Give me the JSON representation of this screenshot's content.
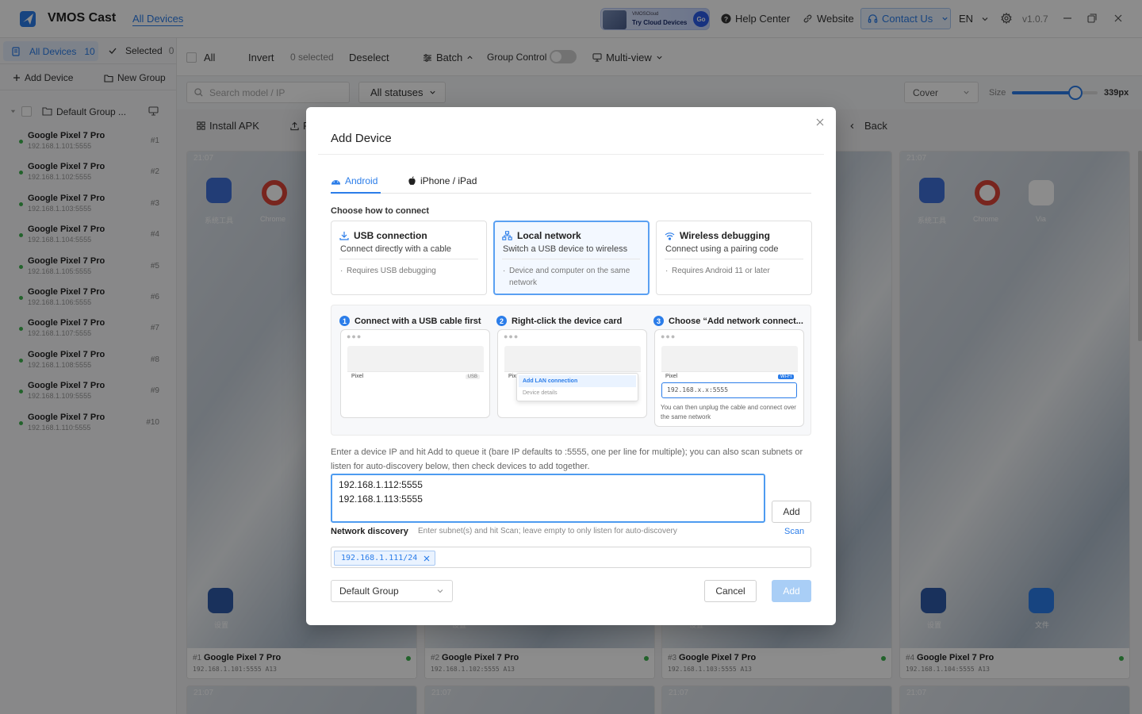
{
  "app": {
    "title": "VMOS Cast",
    "version": "v1.0.7",
    "brand_color": "#2b7de9"
  },
  "titlebar": {
    "all_devices": "All Devices",
    "banner_small": "VMOSCloud",
    "banner_text": "Try Cloud Devices",
    "banner_go": "Go",
    "help": "Help Center",
    "website": "Website",
    "contact": "Contact Us",
    "lang": "EN"
  },
  "sidebar": {
    "tab_all": "All Devices",
    "tab_all_count": "10",
    "tab_selected": "Selected",
    "tab_selected_count": "0",
    "add_device": "Add Device",
    "new_group": "New Group",
    "group_name": "Default Group ...",
    "devices": [
      {
        "name": "Google Pixel 7 Pro",
        "ip": "192.168.1.101:5555",
        "num": "#1"
      },
      {
        "name": "Google Pixel 7 Pro",
        "ip": "192.168.1.102:5555",
        "num": "#2"
      },
      {
        "name": "Google Pixel 7 Pro",
        "ip": "192.168.1.103:5555",
        "num": "#3"
      },
      {
        "name": "Google Pixel 7 Pro",
        "ip": "192.168.1.104:5555",
        "num": "#4"
      },
      {
        "name": "Google Pixel 7 Pro",
        "ip": "192.168.1.105:5555",
        "num": "#5"
      },
      {
        "name": "Google Pixel 7 Pro",
        "ip": "192.168.1.106:5555",
        "num": "#6"
      },
      {
        "name": "Google Pixel 7 Pro",
        "ip": "192.168.1.107:5555",
        "num": "#7"
      },
      {
        "name": "Google Pixel 7 Pro",
        "ip": "192.168.1.108:5555",
        "num": "#8"
      },
      {
        "name": "Google Pixel 7 Pro",
        "ip": "192.168.1.109:5555",
        "num": "#9"
      },
      {
        "name": "Google Pixel 7 Pro",
        "ip": "192.168.1.110:5555",
        "num": "#10"
      }
    ]
  },
  "toolbar": {
    "all": "All",
    "invert": "Invert",
    "selected_count": "0 selected",
    "deselect": "Deselect",
    "batch": "Batch",
    "group_control": "Group Control",
    "multiview": "Multi-view"
  },
  "filter": {
    "search_placeholder": "Search model / IP",
    "status": "All statuses",
    "cover": "Cover",
    "size_label": "Size",
    "size_value": "339px",
    "size_fraction": 0.75
  },
  "toolbar2": {
    "install_apk": "Install APK",
    "partial": "F",
    "back": "Back"
  },
  "cards": [
    {
      "num": "#1",
      "name": "Google Pixel 7 Pro",
      "ip": "192.168.1.101:5555 A13",
      "time": "21:07"
    },
    {
      "num": "#2",
      "name": "Google Pixel 7 Pro",
      "ip": "192.168.1.102:5555 A13",
      "time": "21:07"
    },
    {
      "num": "#3",
      "name": "Google Pixel 7 Pro",
      "ip": "192.168.1.103:5555 A13",
      "time": "21:07"
    },
    {
      "num": "#4",
      "name": "Google Pixel 7 Pro",
      "ip": "192.168.1.104:5555 A13",
      "time": "21:07"
    }
  ],
  "app_labels": {
    "tools": "系统工具",
    "chrome": "Chrome",
    "via": "Via",
    "settings": "设置",
    "files": "文件"
  },
  "dialog": {
    "title": "Add Device",
    "tab_android": "Android",
    "tab_iphone": "iPhone / iPad",
    "choose_label": "Choose how to connect",
    "options": [
      {
        "title": "USB connection",
        "sub": "Connect directly with a cable",
        "note": "Requires USB debugging"
      },
      {
        "title": "Local network",
        "sub": "Switch a USB device to wireless",
        "note": "Device and computer on the same network"
      },
      {
        "title": "Wireless debugging",
        "sub": "Connect using a pairing code",
        "note": "Requires Android 11 or later"
      }
    ],
    "steps": [
      {
        "n": "1",
        "title": "Connect with a USB cable first"
      },
      {
        "n": "2",
        "title": "Right-click the device card"
      },
      {
        "n": "3",
        "title": "Choose “Add network connect..."
      }
    ],
    "mock": {
      "pixel": "Pixel",
      "usb": "USB",
      "pix": "Pix",
      "ctx_add": "Add LAN connection",
      "ctx_details": "Device details",
      "wifi": "Wi-Fi",
      "ip_placeholder": "192.168.x.x:5555",
      "note": "You can then unplug the cable and connect over the same network"
    },
    "description": "Enter a device IP and hit Add to queue it (bare IP defaults to :5555, one per line for multiple); you can also scan subnets or listen for auto-discovery below, then check devices to add together.",
    "ip_input": "192.168.1.112:5555\n192.168.1.113:5555",
    "add_small": "Add",
    "nd_label": "Network discovery",
    "nd_hint": "Enter subnet(s) and hit Scan; leave empty to only listen for auto-discovery",
    "scan": "Scan",
    "subnet_tag": "192.168.1.111/24",
    "group": "Default Group",
    "cancel": "Cancel",
    "add": "Add"
  }
}
